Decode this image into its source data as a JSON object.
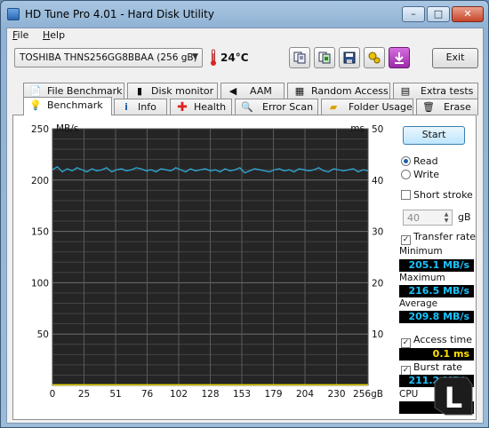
{
  "window": {
    "title": "HD Tune Pro 4.01 - Hard Disk Utility",
    "minimize": "–",
    "maximize": "□",
    "close": "✕"
  },
  "menu": [
    {
      "label": "File",
      "accel": "F",
      "rest": "ile"
    },
    {
      "label": "Help",
      "accel": "H",
      "rest": "elp"
    }
  ],
  "toolbar": {
    "drive": "TOSHIBA THNS256GG8BBAA   (256 gB)",
    "temperature": "24°C",
    "exit_label": "Exit",
    "buttons": [
      "copy-text-icon",
      "copy-screenshot-icon",
      "save-icon",
      "options-icon",
      "download-icon"
    ]
  },
  "tabs_top": [
    {
      "label": "File Benchmark",
      "icon": "file-benchmark-icon"
    },
    {
      "label": "Disk monitor",
      "icon": "disk-monitor-icon"
    },
    {
      "label": "AAM",
      "icon": "speaker-icon"
    },
    {
      "label": "Random Access",
      "icon": "random-access-icon"
    },
    {
      "label": "Extra tests",
      "icon": "extra-tests-icon"
    }
  ],
  "tabs_bottom": [
    {
      "label": "Benchmark",
      "icon": "benchmark-icon",
      "active": true
    },
    {
      "label": "Info",
      "icon": "info-icon"
    },
    {
      "label": "Health",
      "icon": "health-icon"
    },
    {
      "label": "Error Scan",
      "icon": "error-scan-icon"
    },
    {
      "label": "Folder Usage",
      "icon": "folder-icon"
    },
    {
      "label": "Erase",
      "icon": "erase-icon"
    }
  ],
  "chart_data": {
    "type": "line",
    "left_unit": "MB/s",
    "right_unit": "ms",
    "y_left_ticks": [
      250,
      200,
      150,
      100,
      50
    ],
    "y_right_ticks": [
      50,
      40,
      30,
      20,
      10
    ],
    "x_ticks": [
      "0",
      "25",
      "51",
      "76",
      "102",
      "128",
      "153",
      "179",
      "204",
      "230",
      "256gB"
    ],
    "ylim_left": [
      0,
      250
    ],
    "ylim_right": [
      0,
      50
    ],
    "xlim": [
      0,
      256
    ],
    "grid": true,
    "series": [
      {
        "role": "transfer rate",
        "color": "#2ea8d8",
        "x": [
          0,
          4,
          8,
          12,
          16,
          20,
          24,
          28,
          32,
          36,
          40,
          44,
          48,
          52,
          56,
          60,
          64,
          68,
          72,
          76,
          80,
          84,
          88,
          92,
          96,
          100,
          104,
          108,
          112,
          116,
          120,
          124,
          128,
          132,
          136,
          140,
          144,
          148,
          152,
          156,
          160,
          164,
          168,
          172,
          176,
          180,
          184,
          188,
          192,
          196,
          200,
          204,
          208,
          212,
          216,
          220,
          224,
          228,
          232,
          236,
          240,
          244,
          248,
          252,
          256
        ],
        "y": [
          210,
          213,
          208,
          211,
          209,
          212,
          210,
          208,
          211,
          209,
          210,
          212,
          208,
          210,
          211,
          209,
          210,
          212,
          211,
          209,
          210,
          208,
          211,
          210,
          209,
          212,
          210,
          208,
          211,
          209,
          210,
          211,
          209,
          210,
          208,
          211,
          209,
          210,
          212,
          207,
          209,
          211,
          210,
          209,
          208,
          210,
          211,
          209,
          210,
          208,
          211,
          210,
          209,
          210,
          212,
          209,
          208,
          211,
          210,
          209,
          210,
          211,
          208,
          210,
          209
        ]
      },
      {
        "role": "access time",
        "color": "#e8d800",
        "x": [
          0,
          16,
          32,
          48,
          64,
          80,
          96,
          112,
          128,
          144,
          160,
          176,
          192,
          208,
          224,
          240,
          256
        ],
        "y": [
          0.1,
          0.1,
          0.1,
          0.1,
          0.1,
          0.1,
          0.1,
          0.1,
          0.1,
          0.1,
          0.1,
          0.1,
          0.1,
          0.1,
          0.1,
          0.1,
          0.1
        ],
        "axis": "right"
      }
    ]
  },
  "side": {
    "start_label": "Start",
    "read_label": "Read",
    "write_label": "Write",
    "short_stroke_label": "Short stroke",
    "short_stroke_value": "40",
    "short_stroke_unit": "gB",
    "transfer_rate_label": "Transfer rate",
    "minimum_label": "Minimum",
    "minimum_value": "205.1 MB/s",
    "maximum_label": "Maximum",
    "maximum_value": "216.5 MB/s",
    "average_label": "Average",
    "average_value": "209.8 MB/s",
    "access_time_label": "Access time",
    "access_time_value": "0.1 ms",
    "burst_rate_label": "Burst rate",
    "burst_rate_value": "211.2 MB/s",
    "cpu_label": "CPU"
  },
  "logo_text": "L"
}
